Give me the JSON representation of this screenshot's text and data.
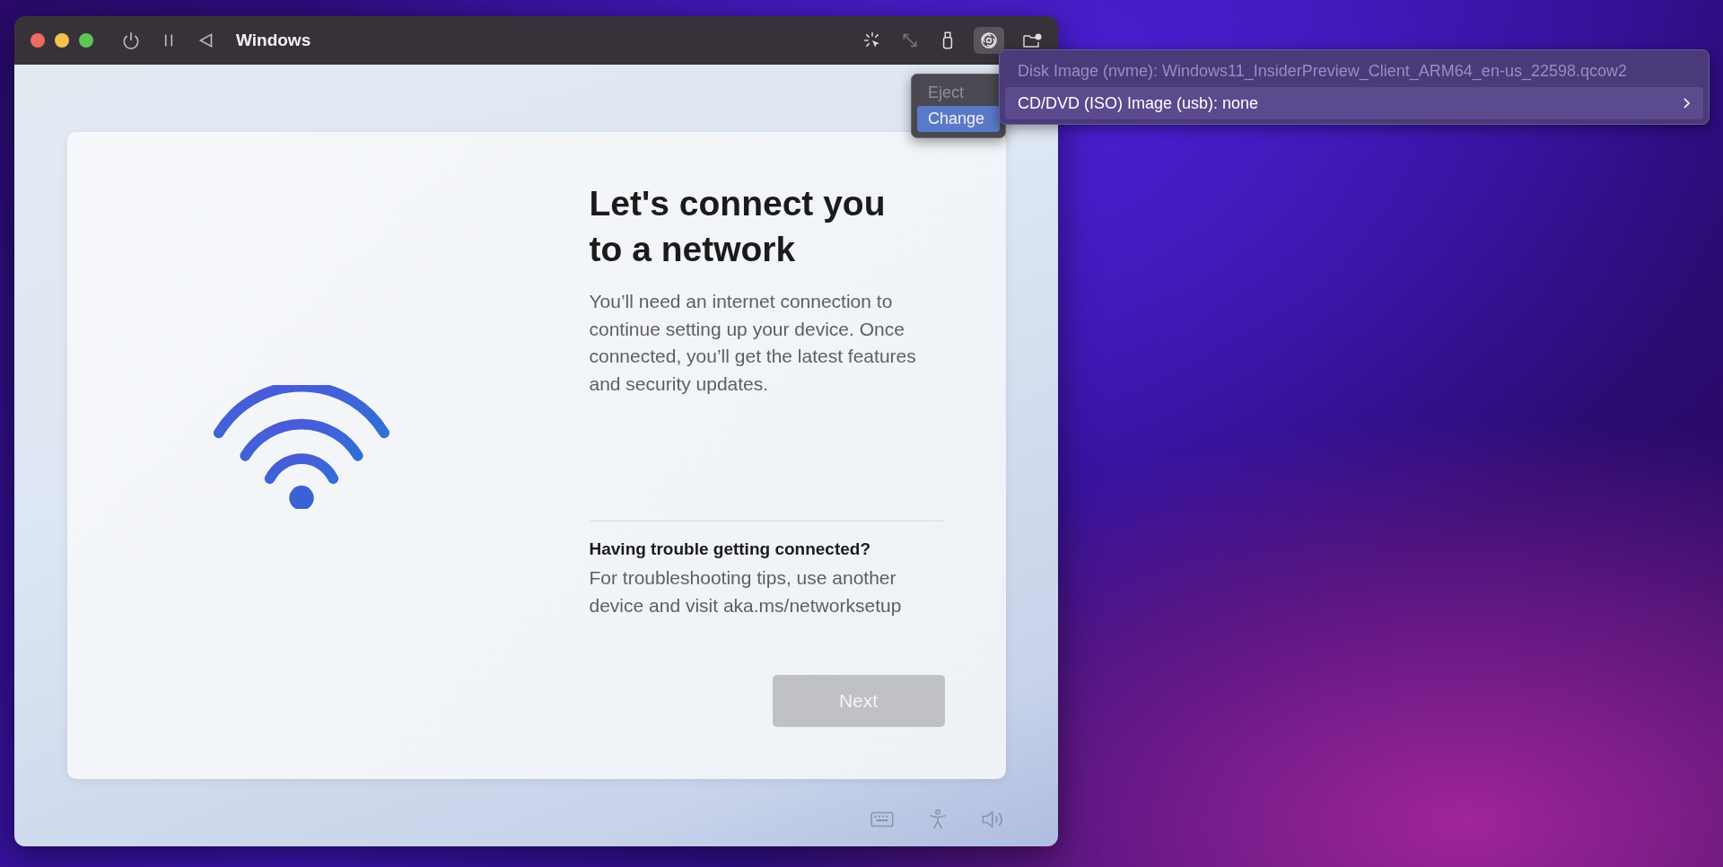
{
  "window": {
    "title": "Windows"
  },
  "setup": {
    "heading": "Let's connect you to a network",
    "body": "You’ll need an internet connection to continue setting up your device. Once connected, you’ll get the latest features and security updates.",
    "trouble_title": "Having trouble getting connected?",
    "trouble_text": "For troubleshooting tips, use another device and visit aka.ms/networksetup",
    "next_button": {
      "label": "Next",
      "disabled": true
    }
  },
  "drive_menu": [
    {
      "label": "Disk Image (nvme): Windows11_InsiderPreview_Client_ARM64_en-us_22598.qcow2",
      "disabled": true,
      "selected": false,
      "submenu": false
    },
    {
      "label": "CD/DVD (ISO) Image (usb): none",
      "disabled": false,
      "selected": true,
      "submenu": true
    }
  ],
  "submenu": [
    {
      "label": "Eject",
      "disabled": true,
      "selected": false
    },
    {
      "label": "Change",
      "disabled": false,
      "selected": true
    }
  ]
}
